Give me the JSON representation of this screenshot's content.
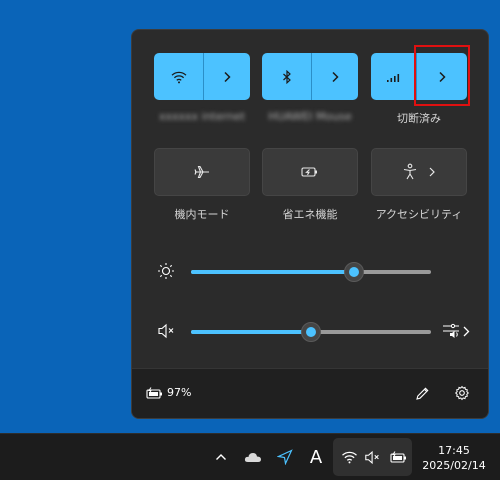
{
  "quick_settings": {
    "wifi": {
      "label": "xxxxxx internet",
      "active": true,
      "icon": "wifi-icon",
      "more_icon": "chevron-right-icon"
    },
    "bluetooth": {
      "label": "HUAWEI Mouse",
      "active": true,
      "icon": "bluetooth-icon",
      "more_icon": "chevron-right-icon"
    },
    "cellular": {
      "label": "切断済み",
      "active": true,
      "icon": "cellular-signal-icon",
      "more_icon": "chevron-right-icon"
    },
    "airplane": {
      "label": "機内モード",
      "active": false,
      "icon": "airplane-icon"
    },
    "energy_saver": {
      "label": "省エネ機能",
      "active": false,
      "icon": "energy-saver-icon"
    },
    "accessibility": {
      "label": "アクセシビリティ",
      "active": false,
      "icon": "accessibility-icon",
      "more_icon": "chevron-right-icon"
    },
    "brightness": {
      "icon": "brightness-icon",
      "level": 0.68
    },
    "volume": {
      "icon": "volume-muted-icon",
      "level": 0.5,
      "output_icon": "sound-output-settings-icon"
    },
    "footer": {
      "battery": "97%",
      "battery_icon": "battery-charging-icon",
      "edit_icon": "pencil-icon",
      "settings_icon": "gear-icon"
    }
  },
  "taskbar": {
    "tray_icons": [
      "chevron-up-icon",
      "onedrive-cloud-icon",
      "location-icon",
      "ime-mode-icon",
      "wifi-icon",
      "volume-muted-icon",
      "battery-charging-icon"
    ],
    "ime_mode": "A",
    "time": "17:45",
    "date": "2025/02/14"
  },
  "colors": {
    "desktop": "#0a64b8",
    "accent": "#4cc2ff",
    "panel": "#2b2b2b",
    "taskbar": "#1c1c1c",
    "highlight": "#e01010"
  }
}
